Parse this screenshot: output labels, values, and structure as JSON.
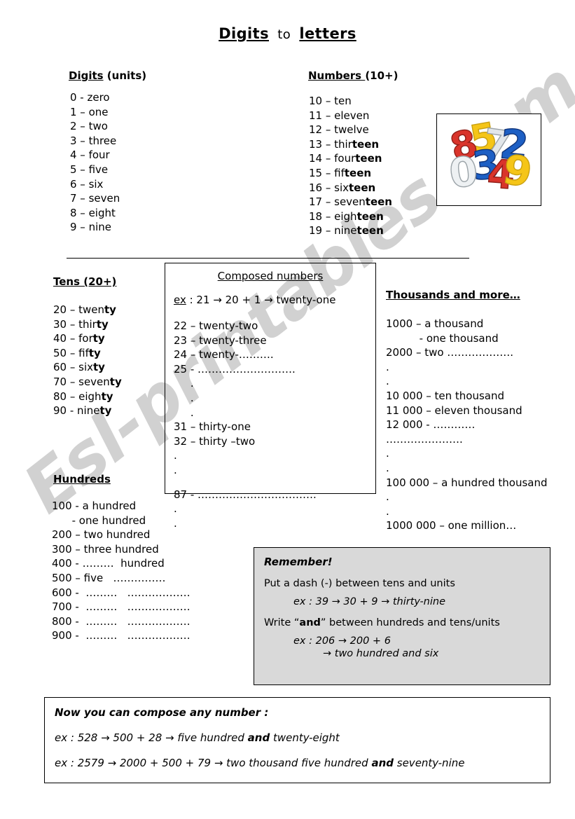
{
  "title": {
    "word1": "Digits",
    "connector": "to",
    "word2": "letters"
  },
  "digits_section": {
    "heading_underlined": "Digits",
    "heading_rest": " (units)",
    "rows": [
      "0 - zero",
      "1 – one",
      "2 – two",
      "3 – three",
      "4 – four",
      "5 – five",
      "6 – six",
      "7 – seven",
      "8 – eight",
      "9 – nine"
    ]
  },
  "numbers_section": {
    "heading_underlined": "Numbers ",
    "heading_rest": "(10+)",
    "rows": [
      {
        "plain": "10 – ten",
        "bold": ""
      },
      {
        "plain": "11 – eleven",
        "bold": ""
      },
      {
        "plain": "12 – twelve",
        "bold": ""
      },
      {
        "plain": "13 – thir",
        "bold": "teen"
      },
      {
        "plain": "14 – four",
        "bold": "teen"
      },
      {
        "plain": "15 – fif",
        "bold": "teen"
      },
      {
        "plain": "16 – six",
        "bold": "teen"
      },
      {
        "plain": "17 – seven",
        "bold": "teen"
      },
      {
        "plain": "18 – eigh",
        "bold": "teen"
      },
      {
        "plain": "19 – nine",
        "bold": "teen"
      }
    ]
  },
  "picture": {
    "name": "number-balloons-image",
    "description": "Foil balloon digits 8 5 7 2 3 0 4 9",
    "digits": [
      "8",
      "5",
      "7",
      "2",
      "3",
      "0",
      "4",
      "9"
    ],
    "colors": {
      "red": "#d9342b",
      "yellow": "#f5c518",
      "blue": "#1d5fc4",
      "silver": "#cfd3d6"
    }
  },
  "tens_section": {
    "heading_underlined": "Tens (20+)",
    "rows": [
      {
        "plain": "20 – twen",
        "bold": "ty"
      },
      {
        "plain": "30 – thir",
        "bold": "ty"
      },
      {
        "plain": "40 – for",
        "bold": "ty"
      },
      {
        "plain": "50 – fif",
        "bold": "ty"
      },
      {
        "plain": "60 – six",
        "bold": "ty"
      },
      {
        "plain": "70 – seven",
        "bold": "ty"
      },
      {
        "plain": "80 – eigh",
        "bold": "ty"
      },
      {
        "plain": "90 - nine",
        "bold": "ty"
      }
    ]
  },
  "hundreds_section": {
    "heading_underlined": "Hundreds",
    "rows": [
      "100 - a hundred",
      "      - one hundred",
      "200 – two hundred",
      "300 – three hundred",
      "400 - ………  hundred",
      "500 – five   ……………",
      "600 -  ………   ………………",
      "700 -  ………   ………………",
      "800 -  ………   ………………",
      "900 -  ………   ………………"
    ]
  },
  "composed_section": {
    "title": "Composed numbers",
    "example": {
      "label": "ex",
      "text": " : 21 →  20 + 1 → twenty-one"
    },
    "rows_a": [
      "22 – twenty-two",
      "23 – twenty-three",
      "24 – twenty-……….",
      "25 - ……………………….",
      "     .",
      "     .",
      "     ."
    ],
    "rows_b": [
      "31 – thirty-one",
      "32 – thirty –two",
      ".",
      "."
    ],
    "rows_c": [
      "87 - …………………………….",
      ".",
      "."
    ]
  },
  "thousands_section": {
    "heading_underlined": "Thousands and more…",
    "rows": [
      "1000 – a thousand",
      "          - one thousand",
      "2000 – two ……………….",
      ".",
      ".",
      "10 000 – ten thousand",
      "11 000 – eleven thousand",
      "12 000 - …………",
      "………………….",
      ".",
      ".",
      "100 000 – a hundred thousand",
      ".",
      ".",
      "1000 000 – one million…"
    ]
  },
  "remember_box": {
    "title": "Remember!",
    "rule1_pre": "Put a dash (-) between tens and units",
    "rule1_example": "ex : 39  →  30 + 9  →  thirty-nine",
    "rule2_pre": "Write “",
    "rule2_bold": "and",
    "rule2_post": "” between hundreds and tens/units",
    "rule2_example_line1": "ex : 206 → 200 + 6",
    "rule2_example_line2": "→  two hundred and six"
  },
  "bottom_box": {
    "title": "Now you can compose any number :",
    "example1_pre": "ex : 528  →  500 + 28  →  five hundred ",
    "example1_bold": "and",
    "example1_post": " twenty-eight",
    "example2_pre": "ex : 2579  →  2000 + 500 + 79  →  two thousand five hundred ",
    "example2_bold": "and",
    "example2_post": " seventy-nine"
  },
  "watermark": {
    "text": "Esl-printables.com",
    "color": "#cfcfcf"
  }
}
